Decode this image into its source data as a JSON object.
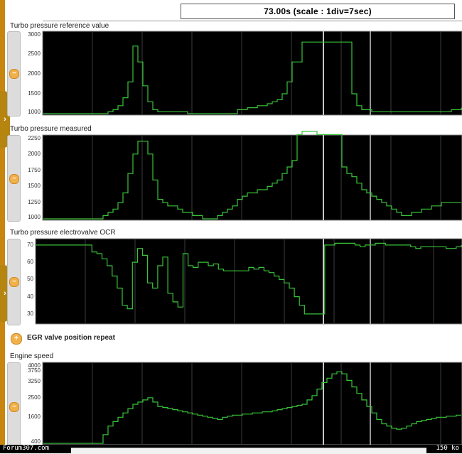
{
  "header": {
    "time_display": "73.00s (scale : 1div=7sec)"
  },
  "channels": [
    {
      "label": "Turbo pressure reference value",
      "ticks": [
        "3000",
        "2500",
        "2000",
        "1500",
        "1000"
      ]
    },
    {
      "label": "Turbo pressure measured",
      "ticks": [
        "2250",
        "2000",
        "1750",
        "1500",
        "1250",
        "1000"
      ]
    },
    {
      "label": "Turbo pressure electrovalve OCR",
      "ticks": [
        "70",
        "60",
        "50",
        "40",
        "30"
      ]
    },
    {
      "label": "EGR valve position repeat"
    },
    {
      "label": "Engine speed",
      "ticks": [
        "4000",
        "3750",
        "3250",
        "2500",
        "1600",
        "400"
      ]
    }
  ],
  "controls": {
    "minus": "−",
    "plus": "+",
    "expand": "›"
  },
  "footer": {
    "watermark": "Forum307.com",
    "filesize": "150 ko"
  },
  "colors": {
    "trace": "#39c439",
    "plot_bg": "#000000",
    "grid": "#3d3d3d",
    "cursor": "#c8c8c8",
    "accent": "#c8860e"
  },
  "chart_data": [
    {
      "type": "line",
      "title": "Turbo pressure reference value",
      "x": [
        0,
        7,
        14,
        21,
        28,
        35,
        42,
        49,
        56,
        63,
        70,
        77,
        84,
        91,
        98,
        105,
        112,
        119,
        126,
        133,
        140,
        147,
        154,
        161,
        168,
        175,
        182,
        189,
        196,
        203,
        210,
        217,
        224,
        231,
        238,
        245,
        252,
        259,
        266,
        273,
        280,
        287,
        294,
        301,
        308,
        315,
        322,
        329,
        336,
        343,
        350,
        357,
        364,
        371,
        378,
        385,
        392,
        399,
        406,
        413,
        420,
        427,
        434,
        441,
        448,
        455,
        462,
        469,
        476,
        483,
        490,
        497,
        504,
        511,
        518,
        525,
        532,
        539,
        546,
        553,
        560,
        567,
        574,
        581,
        588
      ],
      "series": [
        {
          "values": [
            1000,
            1000,
            1000,
            1000,
            1000,
            1000,
            1000,
            1000,
            1000,
            1000,
            1000,
            1000,
            1000,
            1050,
            1100,
            1200,
            1400,
            1800,
            2700,
            2300,
            1700,
            1300,
            1100,
            1050,
            1050,
            1050,
            1050,
            1050,
            1050,
            1000,
            1000,
            1000,
            1000,
            1000,
            1000,
            1000,
            1000,
            1000,
            1000,
            1100,
            1100,
            1150,
            1150,
            1200,
            1200,
            1250,
            1300,
            1350,
            1500,
            1800,
            2300,
            2300,
            2800,
            2800,
            2800,
            2800,
            2800,
            2800,
            2800,
            2800,
            2800,
            2800,
            1500,
            1200,
            1100,
            1100,
            1050,
            1050,
            1050,
            1050,
            1050,
            1050,
            1050,
            1050,
            1050,
            1050,
            1050,
            1050,
            1050,
            1050,
            1050,
            1050,
            1100,
            1100,
            1150
          ]
        }
      ],
      "ylim": [
        1000,
        3000
      ]
    },
    {
      "type": "line",
      "title": "Turbo pressure measured",
      "x": [
        0,
        7,
        14,
        21,
        28,
        35,
        42,
        49,
        56,
        63,
        70,
        77,
        84,
        91,
        98,
        105,
        112,
        119,
        126,
        133,
        140,
        147,
        154,
        161,
        168,
        175,
        182,
        189,
        196,
        203,
        210,
        217,
        224,
        231,
        238,
        245,
        252,
        259,
        266,
        273,
        280,
        287,
        294,
        301,
        308,
        315,
        322,
        329,
        336,
        343,
        350,
        357,
        364,
        371,
        378,
        385,
        392,
        399,
        406,
        413,
        420,
        427,
        434,
        441,
        448,
        455,
        462,
        469,
        476,
        483,
        490,
        497,
        504,
        511,
        518,
        525,
        532,
        539,
        546,
        553,
        560,
        567,
        574,
        581,
        588
      ],
      "series": [
        {
          "values": [
            1000,
            1000,
            1000,
            1000,
            1000,
            1000,
            1000,
            1000,
            1000,
            1000,
            1000,
            1000,
            1050,
            1100,
            1150,
            1250,
            1400,
            1700,
            2000,
            2200,
            2200,
            2000,
            1600,
            1300,
            1250,
            1200,
            1200,
            1150,
            1100,
            1100,
            1050,
            1050,
            1000,
            1000,
            1000,
            1050,
            1100,
            1150,
            1200,
            1300,
            1350,
            1400,
            1400,
            1450,
            1450,
            1500,
            1550,
            1600,
            1700,
            1800,
            1900,
            2300,
            2350,
            2350,
            2350,
            2300,
            2300,
            2300,
            2300,
            2300,
            1800,
            1700,
            1650,
            1550,
            1450,
            1400,
            1350,
            1300,
            1250,
            1200,
            1150,
            1100,
            1050,
            1050,
            1100,
            1100,
            1150,
            1150,
            1200,
            1200,
            1250,
            1250,
            1250,
            1250,
            1250
          ]
        }
      ],
      "ylim": [
        1000,
        2250
      ]
    },
    {
      "type": "line",
      "title": "Turbo pressure electrovalve OCR",
      "x": [
        0,
        7,
        14,
        21,
        28,
        35,
        42,
        49,
        56,
        63,
        70,
        77,
        84,
        91,
        98,
        105,
        112,
        119,
        126,
        133,
        140,
        147,
        154,
        161,
        168,
        175,
        182,
        189,
        196,
        203,
        210,
        217,
        224,
        231,
        238,
        245,
        252,
        259,
        266,
        273,
        280,
        287,
        294,
        301,
        308,
        315,
        322,
        329,
        336,
        343,
        350,
        357,
        364,
        371,
        378,
        385,
        392,
        399,
        406,
        413,
        420,
        427,
        434,
        441,
        448,
        455,
        462,
        469,
        476,
        483,
        490,
        497,
        504,
        511,
        518,
        525,
        532,
        539,
        546,
        553,
        560,
        567,
        574,
        581,
        588
      ],
      "series": [
        {
          "values": [
            70,
            70,
            70,
            70,
            70,
            70,
            70,
            70,
            70,
            70,
            70,
            66,
            65,
            62,
            58,
            52,
            45,
            35,
            33,
            60,
            68,
            64,
            48,
            45,
            58,
            63,
            42,
            37,
            34,
            65,
            58,
            57,
            60,
            60,
            58,
            59,
            56,
            55,
            55,
            55,
            55,
            55,
            57,
            56,
            57,
            55,
            54,
            52,
            50,
            48,
            45,
            40,
            35,
            30,
            30,
            30,
            30,
            70,
            70,
            71,
            71,
            71,
            71,
            70,
            69,
            70,
            70,
            71,
            71,
            70,
            70,
            70,
            70,
            70,
            69,
            68,
            69,
            69,
            69,
            69,
            69,
            68,
            68,
            69,
            70
          ]
        }
      ],
      "ylim": [
        25,
        72
      ]
    },
    {
      "type": "line",
      "title": "Engine speed",
      "x": [
        0,
        7,
        14,
        21,
        28,
        35,
        42,
        49,
        56,
        63,
        70,
        77,
        84,
        91,
        98,
        105,
        112,
        119,
        126,
        133,
        140,
        147,
        154,
        161,
        168,
        175,
        182,
        189,
        196,
        203,
        210,
        217,
        224,
        231,
        238,
        245,
        252,
        259,
        266,
        273,
        280,
        287,
        294,
        301,
        308,
        315,
        322,
        329,
        336,
        343,
        350,
        357,
        364,
        371,
        378,
        385,
        392,
        399,
        406,
        413,
        420,
        427,
        434,
        441,
        448,
        455,
        462,
        469,
        476,
        483,
        490,
        497,
        504,
        511,
        518,
        525,
        532,
        539,
        546,
        553,
        560,
        567,
        574,
        581,
        588
      ],
      "series": [
        {
          "values": [
            400,
            400,
            400,
            400,
            400,
            400,
            400,
            400,
            400,
            400,
            400,
            400,
            800,
            1200,
            1400,
            1600,
            1800,
            2000,
            2200,
            2300,
            2400,
            2500,
            2300,
            2100,
            2050,
            2000,
            1950,
            1900,
            1850,
            1800,
            1750,
            1700,
            1650,
            1600,
            1550,
            1500,
            1600,
            1650,
            1700,
            1700,
            1750,
            1750,
            1800,
            1800,
            1850,
            1850,
            1900,
            1950,
            2000,
            2050,
            2100,
            2150,
            2200,
            2400,
            2600,
            2900,
            3200,
            3400,
            3600,
            3700,
            3600,
            3300,
            3000,
            2700,
            2400,
            2100,
            1800,
            1500,
            1300,
            1200,
            1100,
            1050,
            1100,
            1200,
            1300,
            1400,
            1450,
            1500,
            1550,
            1600,
            1600,
            1650,
            1650,
            1700,
            1700
          ]
        }
      ],
      "ylim": [
        400,
        4000
      ]
    }
  ]
}
